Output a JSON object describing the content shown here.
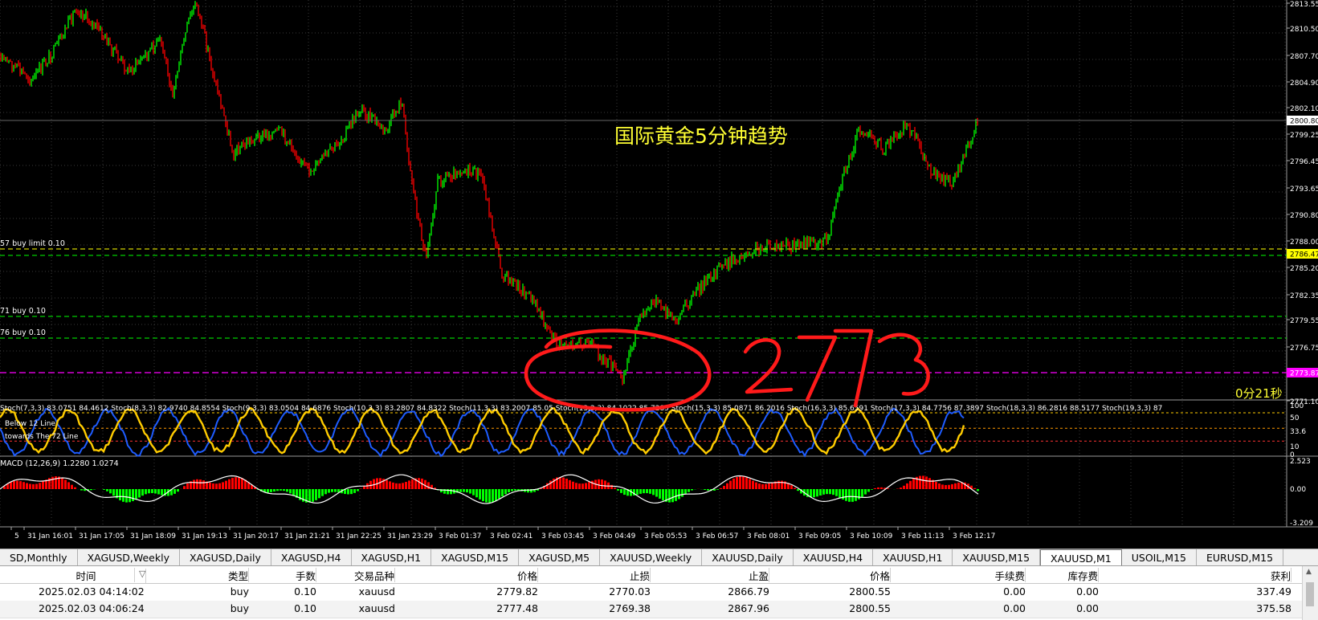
{
  "chart": {
    "annotation_title": "国际黄金5分钟趋势",
    "handwritten_price": "2773",
    "countdown": "0分21秒",
    "colors": {
      "bull": "#00ff00",
      "bear": "#ff0000",
      "grid": "#3a3a3a",
      "text": "#ffffff",
      "annotation": "#ffff33",
      "order_line": "#00cc00",
      "alert_line": "#ff00ff",
      "current_price_bg": "#ffff00",
      "stoch_main": "#ffcc00",
      "stoch_signal": "#1e5cff",
      "macd_signal": "#ffffff"
    },
    "price_axis": {
      "ticks": [
        "2813.55",
        "2810.50",
        "2807.70",
        "2804.90",
        "2802.10",
        "2799.25",
        "2796.45",
        "2793.65",
        "2790.80",
        "2788.00",
        "2785.20",
        "2782.35",
        "2779.55",
        "2776.75",
        "2771.10"
      ],
      "current_price": "2800.80",
      "order_price_tag": "2786.47",
      "alert_price_tag": "2773.87"
    },
    "order_labels": [
      "57 buy limit 0.10",
      "71 buy 0.10",
      "76 buy 0.10"
    ],
    "stochastic": {
      "header_fragments": [
        "Stoch(7,3,3) 83.0751 84.4612",
        "Stoch(8,3,3) 82.9740 84.8554",
        "Stoch(9,3,3) 83.0504 84.6876",
        "Stoch(10,3,3) 83.2807 84.8322",
        "Stoch(11,3,3) 83.2007 85.05",
        "Stoch(13,3,3) 84.1022 85.7285",
        "Stoch(15,3,3) 85.0871 86.2016",
        "Stoch(16,3,3) 85.6591",
        "Stoch(17,3,3) 84.7756 87.3897",
        "Stoch(18,3,3) 86.2816 88.5177",
        "Stoch(19,3,3) 87"
      ],
      "legend_lines": [
        "Below 12 Line",
        "towards The 72 Line"
      ],
      "axis": [
        "100",
        "50",
        "33.6",
        "10",
        "0"
      ]
    },
    "macd": {
      "label": "MACD (12,26,9) 1.2280 1.0274",
      "axis": [
        "2.523",
        "0.00",
        "-3.209"
      ]
    },
    "time_axis": [
      "5",
      "31 Jan 16:01",
      "31 Jan 17:05",
      "31 Jan 18:09",
      "31 Jan 19:13",
      "31 Jan 20:17",
      "31 Jan 21:21",
      "31 Jan 22:25",
      "31 Jan 23:29",
      "3 Feb 01:37",
      "3 Feb 02:41",
      "3 Feb 03:45",
      "3 Feb 04:49",
      "3 Feb 05:53",
      "3 Feb 06:57",
      "3 Feb 08:01",
      "3 Feb 09:05",
      "3 Feb 10:09",
      "3 Feb 11:13",
      "3 Feb 12:17"
    ]
  },
  "tabs": [
    {
      "label": "SD,Monthly"
    },
    {
      "label": "XAGUSD,Weekly"
    },
    {
      "label": "XAGUSD,Daily"
    },
    {
      "label": "XAGUSD,H4"
    },
    {
      "label": "XAGUSD,H1"
    },
    {
      "label": "XAGUSD,M15"
    },
    {
      "label": "XAGUSD,M5"
    },
    {
      "label": "XAUUSD,Weekly"
    },
    {
      "label": "XAUUSD,Daily"
    },
    {
      "label": "XAUUSD,H4"
    },
    {
      "label": "XAUUSD,H1"
    },
    {
      "label": "XAUUSD,M15"
    },
    {
      "label": "XAUUSD,M1",
      "active": true
    },
    {
      "label": "USOIL,M15"
    },
    {
      "label": "EURUSD,M15"
    }
  ],
  "orders": {
    "columns": [
      "时间",
      "类型",
      "手数",
      "交易品种",
      "价格",
      "止损",
      "止盈",
      "价格",
      "手续费",
      "库存费",
      "获利"
    ],
    "sort_indicator": "▽",
    "rows": [
      [
        "2025.02.03 04:14:02",
        "buy",
        "0.10",
        "xauusd",
        "2779.82",
        "2770.03",
        "2866.79",
        "2800.55",
        "0.00",
        "0.00",
        "337.49"
      ],
      [
        "2025.02.03 04:06:24",
        "buy",
        "0.10",
        "xauusd",
        "2777.48",
        "2769.38",
        "2867.96",
        "2800.55",
        "0.00",
        "0.00",
        "375.58"
      ]
    ]
  }
}
